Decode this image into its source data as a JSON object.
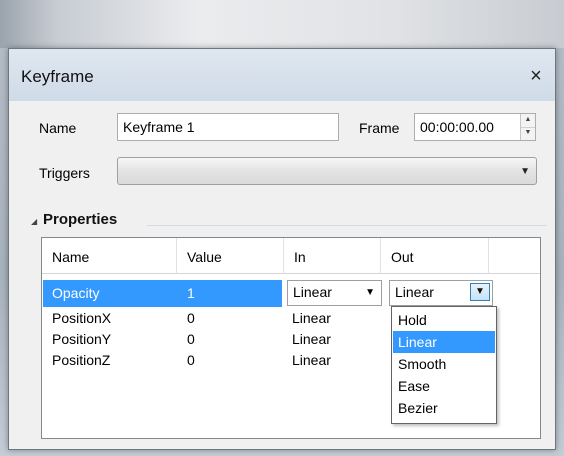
{
  "dialog": {
    "title": "Keyframe",
    "close_glyph": "×"
  },
  "form": {
    "name_label": "Name",
    "name_value": "Keyframe 1",
    "frame_label": "Frame",
    "frame_value": "00:00:00.00",
    "triggers_label": "Triggers",
    "triggers_value": ""
  },
  "properties": {
    "section_title": "Properties",
    "columns": [
      "Name",
      "Value",
      "In",
      "Out"
    ],
    "rows": [
      {
        "name": "Opacity",
        "value": "1",
        "in": "Linear",
        "out": "Linear"
      },
      {
        "name": "PositionX",
        "value": "0",
        "in": "Linear"
      },
      {
        "name": "PositionY",
        "value": "0",
        "in": "Linear"
      },
      {
        "name": "PositionZ",
        "value": "0",
        "in": "Linear"
      }
    ],
    "out_dropdown": {
      "options": [
        "Hold",
        "Linear",
        "Smooth",
        "Ease",
        "Bezier"
      ],
      "highlighted": "Linear"
    }
  },
  "icons": {
    "close": "close-icon",
    "collapse": "collapse-triangle-icon",
    "dropdown": "chevron-down-icon",
    "spin_up": "spin-up-icon",
    "spin_down": "spin-down-icon"
  },
  "colors": {
    "selection": "#3399ff",
    "titlebar": "#cfdbe8"
  }
}
